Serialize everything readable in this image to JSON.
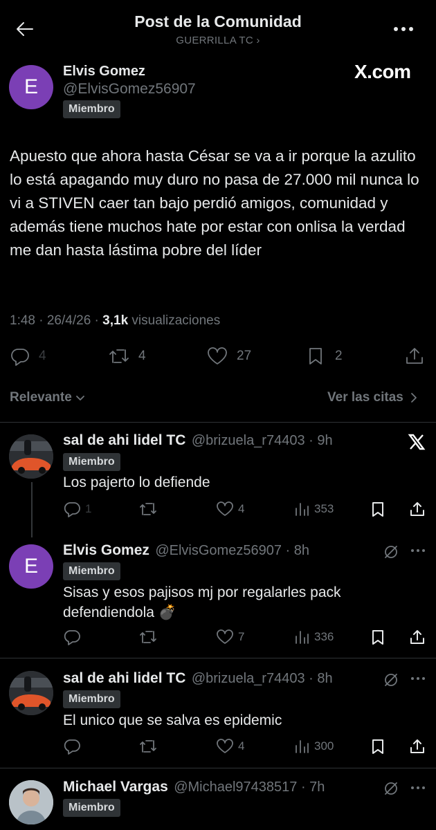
{
  "header": {
    "title": "Post de la Comunidad",
    "community": "GUERRILLA TC ›"
  },
  "post": {
    "author_name": "Elvis Gomez",
    "author_handle": "@ElvisGomez56907",
    "author_initial": "E",
    "badge": "Miembro",
    "watermark": "X.com",
    "text": "Apuesto que ahora hasta César se va a ir porque la azulito lo está apagando muy duro no pasa de 27.000 mil nunca lo vi a STIVEN caer tan bajo perdió amigos, comunidad y además tiene muchos hate por estar con onlisa la verdad me dan hasta lástima pobre del líder",
    "time": "1:48 · 26/4/26 · ",
    "views_count": "3,1k",
    "views_label": " visualizaciones",
    "replies": "4",
    "reposts": "4",
    "likes": "27",
    "bookmarks": "2"
  },
  "sort": {
    "left": "Relevante",
    "right": "Ver las citas"
  },
  "replies": [
    {
      "name": "sal de ahi lidel TC",
      "handle": "@brizuela_r74403 · 9h",
      "badge": "Miembro",
      "text": "Los pajerto lo defiende",
      "replies": "1",
      "reposts": "",
      "likes": "4",
      "views": "353"
    },
    {
      "name": "Elvis Gomez",
      "handle": "@ElvisGomez56907 · 8h",
      "initial": "E",
      "badge": "Miembro",
      "text": "Sisas y esos pajisos mj por regalarles pack defendiendola 💣",
      "replies": "",
      "reposts": "",
      "likes": "7",
      "views": "336"
    },
    {
      "name": "sal de ahi lidel TC",
      "handle": "@brizuela_r74403 · 8h",
      "badge": "Miembro",
      "text": "El unico que se salva es epidemic",
      "replies": "",
      "reposts": "",
      "likes": "4",
      "views": "300"
    },
    {
      "name": "Michael Vargas",
      "handle": "@Michael97438517 · 7h",
      "badge": "Miembro"
    }
  ],
  "colors": {
    "background": "#000000",
    "text": "#e7e9ea",
    "muted": "#71767b",
    "avatar_purple": "#7b3fb5",
    "divider": "#2f3336"
  }
}
